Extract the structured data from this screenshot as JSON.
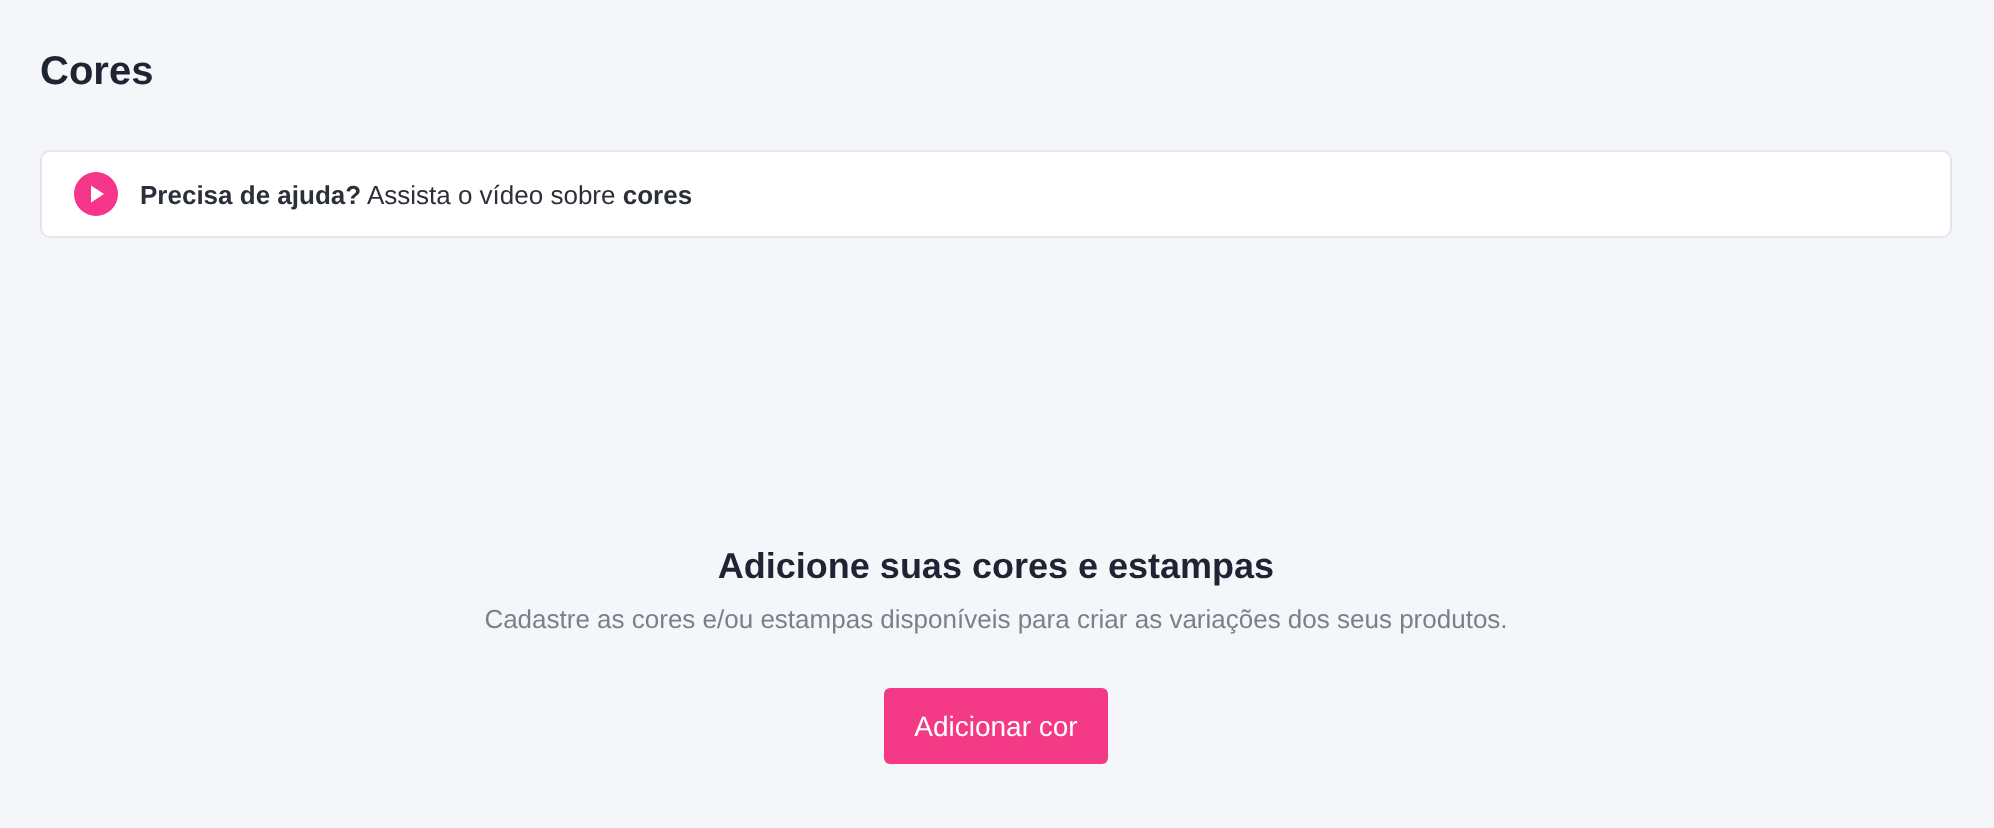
{
  "page": {
    "title": "Cores"
  },
  "help_banner": {
    "text": "**Precisa de ajuda?** Assista o vídeo sobre **cores**"
  },
  "empty_state": {
    "title": "Adicione suas cores e estampas",
    "description": "Cadastre as cores e/ou estampas disponíveis para criar as variações dos seus produtos.",
    "button": "Adicionar cor"
  }
}
